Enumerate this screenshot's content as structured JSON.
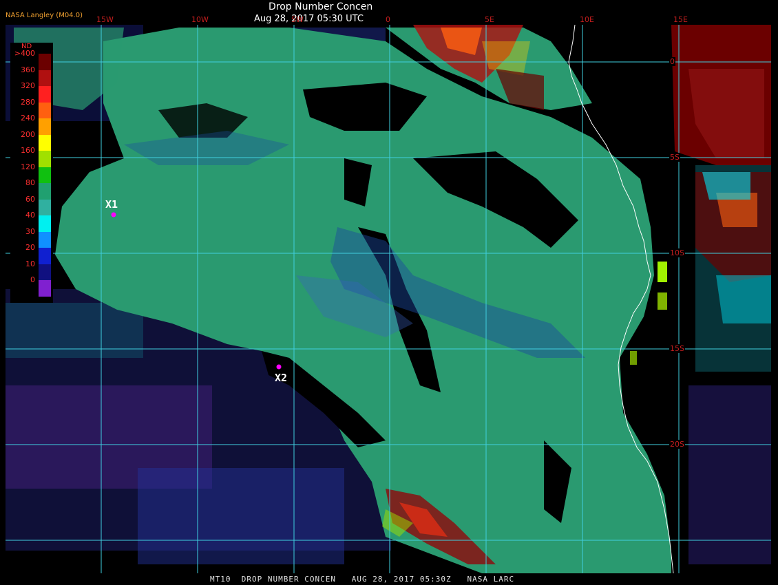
{
  "header": {
    "source": "NASA Langley (M04.0)",
    "title": "Drop Number Concen",
    "timestamp": "Aug 28, 2017 05:30 UTC"
  },
  "longitude_labels": [
    "15W",
    "10W",
    "5W",
    "0",
    "5E",
    "10E",
    "15E"
  ],
  "latitude_labels": [
    "0",
    "5S",
    "10S",
    "15S",
    "20S"
  ],
  "legend": {
    "unit": "ND",
    "ticks": [
      ">400",
      "360",
      "320",
      "280",
      "240",
      "200",
      "160",
      "120",
      "80",
      "60",
      "40",
      "30",
      "20",
      "10",
      "0"
    ],
    "colors": [
      "#6b0000",
      "#b01010",
      "#ff2020",
      "#ff6010",
      "#ffa000",
      "#ffff00",
      "#a0e000",
      "#10c010",
      "#20a070",
      "#30b0a0",
      "#00f0f0",
      "#1090ff",
      "#1020d0",
      "#101080",
      "#8020d0"
    ]
  },
  "markers": [
    {
      "label": "X1",
      "color": "#ff00ff"
    },
    {
      "label": "X2",
      "color": "#ff00ff"
    }
  ],
  "palette": {
    "cloud_main": "#2a9a70",
    "grid": "#40d0e0",
    "coast": "#ffffff"
  },
  "footer": "MT10  DROP NUMBER CONCEN   AUG 28, 2017 05:30Z   NASA LARC"
}
